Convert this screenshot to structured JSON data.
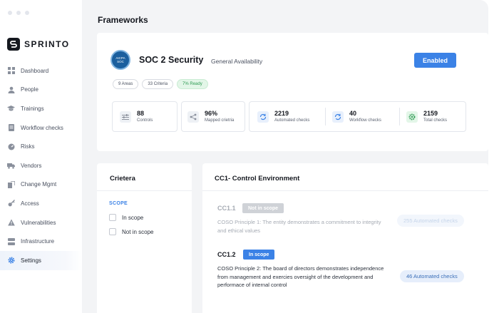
{
  "brand": {
    "name": "SPRINTO"
  },
  "sidebar": {
    "items": [
      {
        "label": "Dashboard",
        "icon": "dashboard-icon"
      },
      {
        "label": "People",
        "icon": "person-icon"
      },
      {
        "label": "Trainings",
        "icon": "graduation-cap-icon"
      },
      {
        "label": "Workflow checks",
        "icon": "checklist-icon"
      },
      {
        "label": "Risks",
        "icon": "gauge-icon"
      },
      {
        "label": "Vendors",
        "icon": "truck-icon"
      },
      {
        "label": "Change Mgmt",
        "icon": "change-icon"
      },
      {
        "label": "Access",
        "icon": "key-icon"
      },
      {
        "label": "Vulnerabilities",
        "icon": "warning-icon"
      },
      {
        "label": "Infrastructure",
        "icon": "server-icon"
      },
      {
        "label": "Settings",
        "icon": "gear-icon",
        "active": true
      }
    ]
  },
  "page": {
    "title": "Frameworks"
  },
  "framework": {
    "logo_text_line1": "AICPA",
    "logo_text_line2": "SOC",
    "name": "SOC 2 Security",
    "status": "General Availability",
    "enabled_label": "Enabled",
    "tags": {
      "areas": "9 Areas",
      "criteria": "33 Criteria",
      "ready": "7% Ready"
    },
    "stats": {
      "controls": {
        "value": "88",
        "label": "Controls"
      },
      "mapped": {
        "value": "96%",
        "label": "Mapped crietria"
      },
      "automated": {
        "value": "2219",
        "label": "Automated checks"
      },
      "workflow": {
        "value": "40",
        "label": "Workflow checks"
      },
      "total": {
        "value": "2159",
        "label": "Total checks"
      }
    }
  },
  "criteria": {
    "title": "Crietera",
    "scope_label": "SCOPE",
    "options": [
      "In scope",
      "Not in scope"
    ]
  },
  "control_env": {
    "title": "CC1- Control Environment",
    "items": [
      {
        "code": "CC1.1",
        "badge": "Not in scope",
        "desc": "COSO Principle 1: The entity demonstrates a commitment to integrity and ethical values",
        "checks": "255 Automated checks"
      },
      {
        "code": "CC1.2",
        "badge": "In scope",
        "desc": "COSO Principle 2: The board of directors demonstrates independence from management and exercies oversight of the development and performace of internal control",
        "checks": "46 Automated checks"
      }
    ]
  },
  "colors": {
    "accent": "#3b82e6",
    "ready_green": "#2e9b53",
    "muted_badge": "#cfd2d7"
  }
}
